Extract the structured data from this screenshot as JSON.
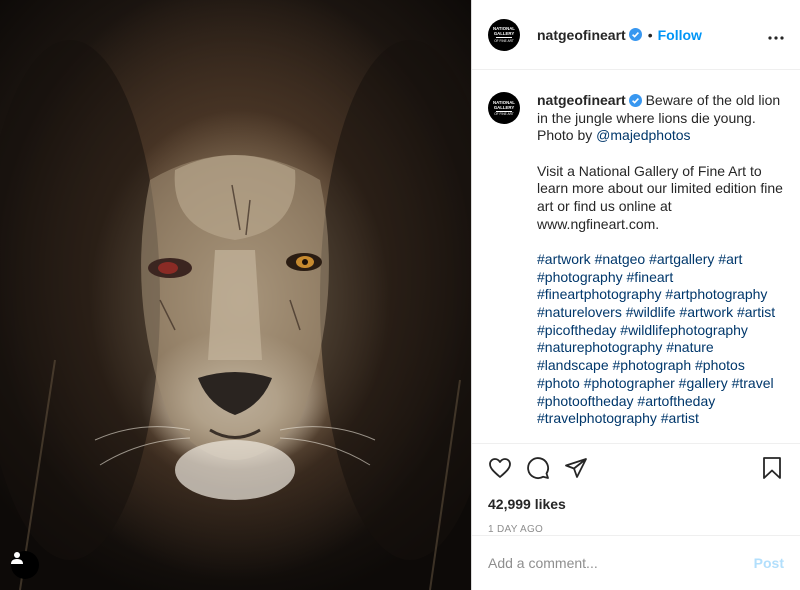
{
  "post": {
    "username": "natgeofineart",
    "verified": true,
    "separator": "•",
    "follow_label": "Follow",
    "more_label": "•••",
    "logo": {
      "line1": "NATIONAL",
      "line2": "GALLERY",
      "line3": "OF FINE ART"
    },
    "image_alt": "Close-up portrait of an old scarred lion"
  },
  "caption": {
    "username": "natgeofineart",
    "text_before_mention": " Beware of the old lion in the jungle where lions die young. Photo by ",
    "mention": "@majedphotos",
    "paragraph2": "Visit a National Gallery of Fine Art to learn more about our limited edition fine art or find us online at www.ngfineart.com.",
    "hashtags": "#artwork #natgeo #artgallery #art #photography #fineart #fineartphotography #artphotography #naturelovers #wildlife #artwork #artist #picoftheday #wildlifephotography #naturephotography #nature #landscape #photograph #photos #photo #photographer #gallery #travel #photooftheday #artoftheday #travelphotography #artist"
  },
  "actions": {
    "icons": [
      "heart-icon",
      "comment-icon",
      "share-icon",
      "bookmark-icon"
    ],
    "likes": "42,999 likes",
    "timestamp": "1 DAY AGO"
  },
  "comment": {
    "placeholder": "Add a comment...",
    "post_label": "Post"
  },
  "colors": {
    "accent": "#0095f6",
    "link": "#00376b",
    "post_disabled": "#b2dffc",
    "muted": "#8e8e8e"
  }
}
